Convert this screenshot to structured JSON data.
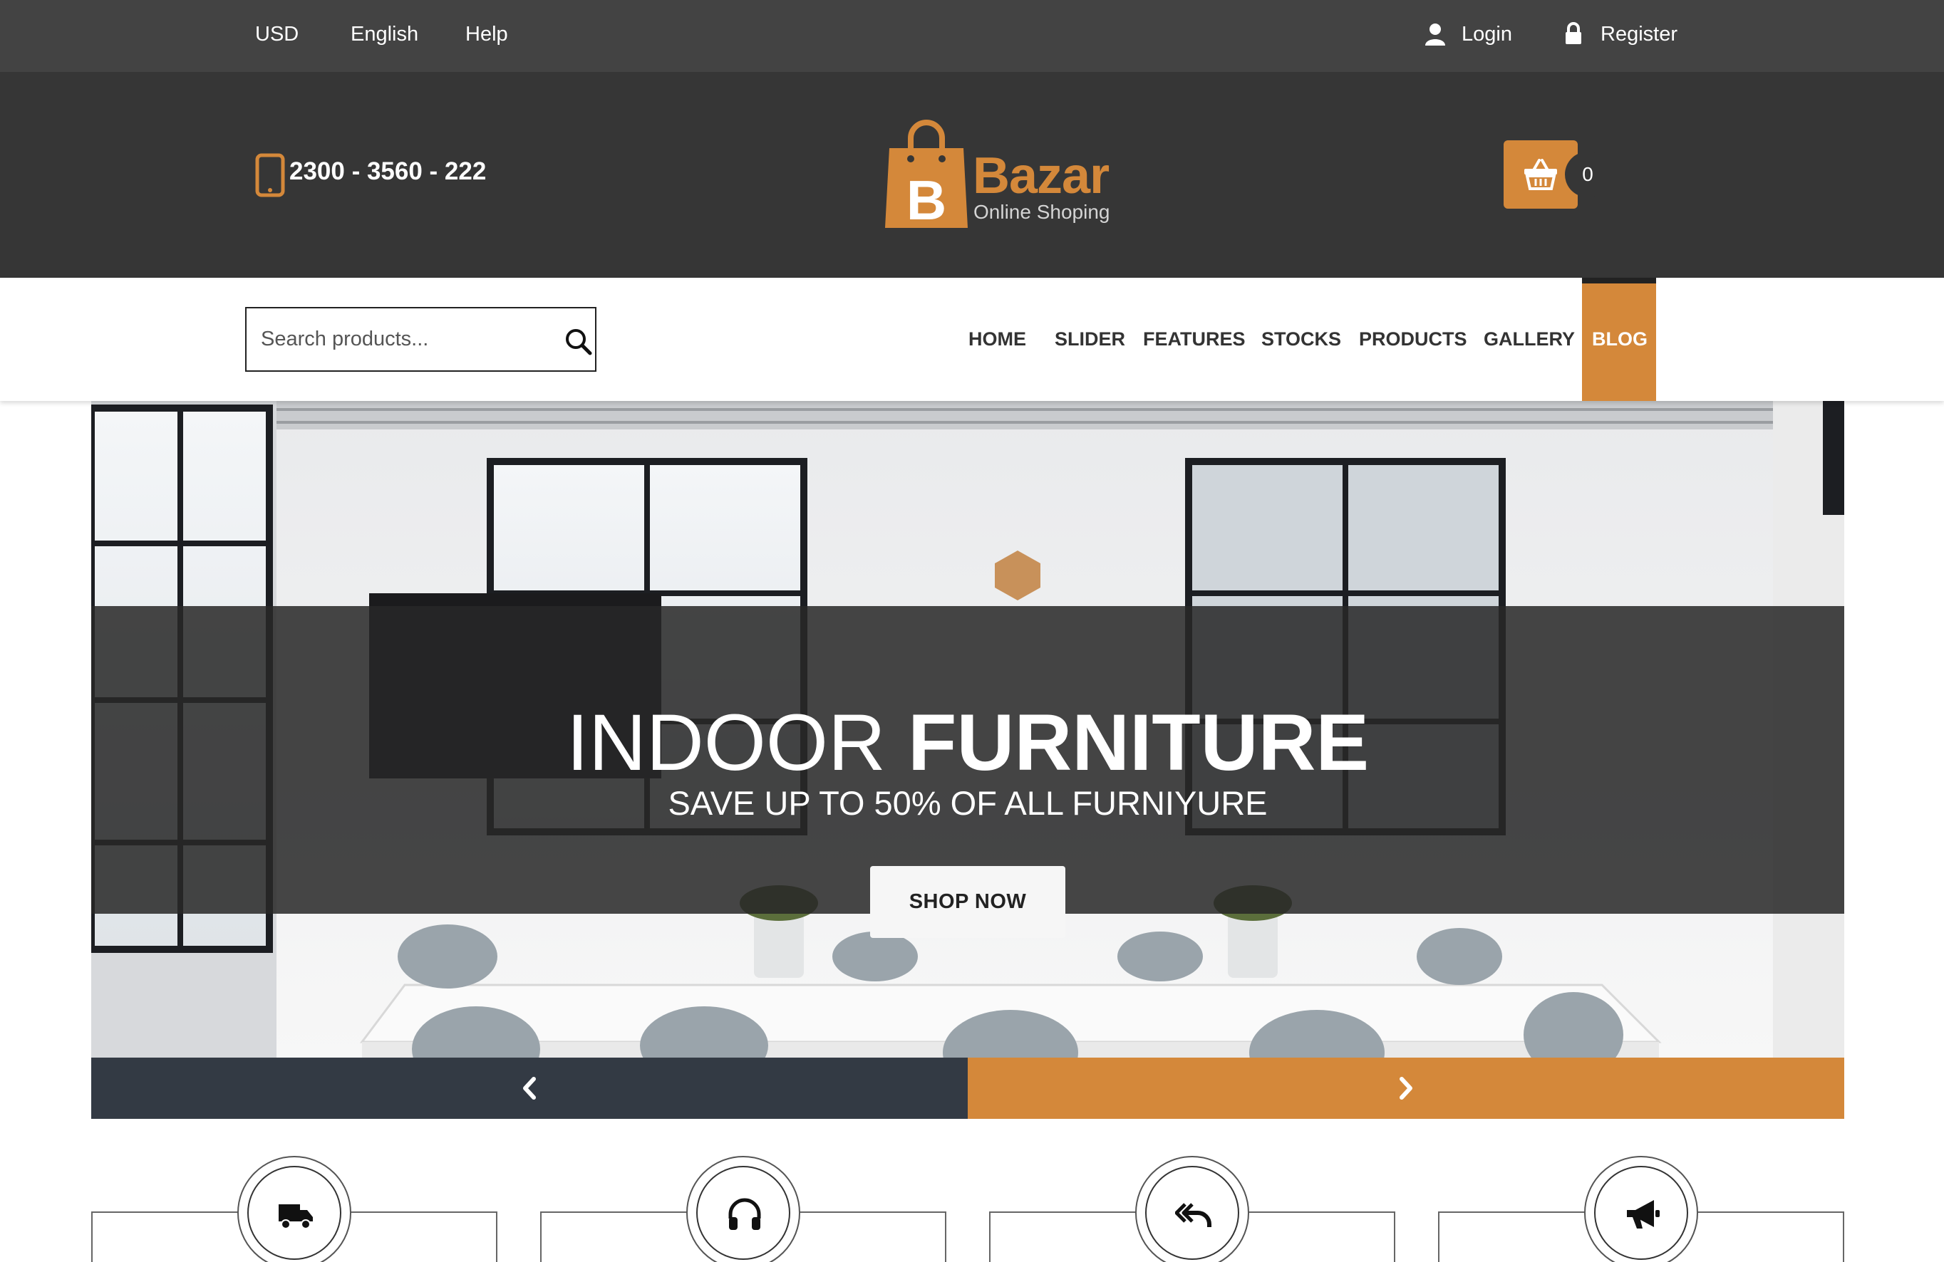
{
  "topbar": {
    "currency": "USD",
    "language": "English",
    "help": "Help",
    "login": "Login",
    "register": "Register"
  },
  "header": {
    "phone": "2300 - 3560 - 222",
    "logo_letter": "B",
    "logo_title": "Bazar",
    "logo_subtitle": "Online Shoping",
    "cart_count": "0"
  },
  "search": {
    "placeholder": "Search products..."
  },
  "nav": {
    "items": [
      {
        "label": "HOME"
      },
      {
        "label": "SLIDER"
      },
      {
        "label": "FEATURES"
      },
      {
        "label": "STOCKS"
      },
      {
        "label": "PRODUCTS"
      },
      {
        "label": "GALLERY"
      },
      {
        "label": "BLOG",
        "active": true
      }
    ]
  },
  "hero": {
    "title_light": "INDOOR ",
    "title_bold": "FURNITURE",
    "subtitle": "SAVE UP TO 50% OF ALL FURNIYURE",
    "cta": "SHOP NOW"
  },
  "features": [
    {
      "icon": "truck-icon"
    },
    {
      "icon": "headphones-icon"
    },
    {
      "icon": "reply-icon"
    },
    {
      "icon": "megaphone-icon"
    }
  ],
  "colors": {
    "accent": "#d4883a",
    "topbar_bg": "#434343",
    "header_bg": "#363636",
    "slider_prev_bg": "#333a44"
  }
}
